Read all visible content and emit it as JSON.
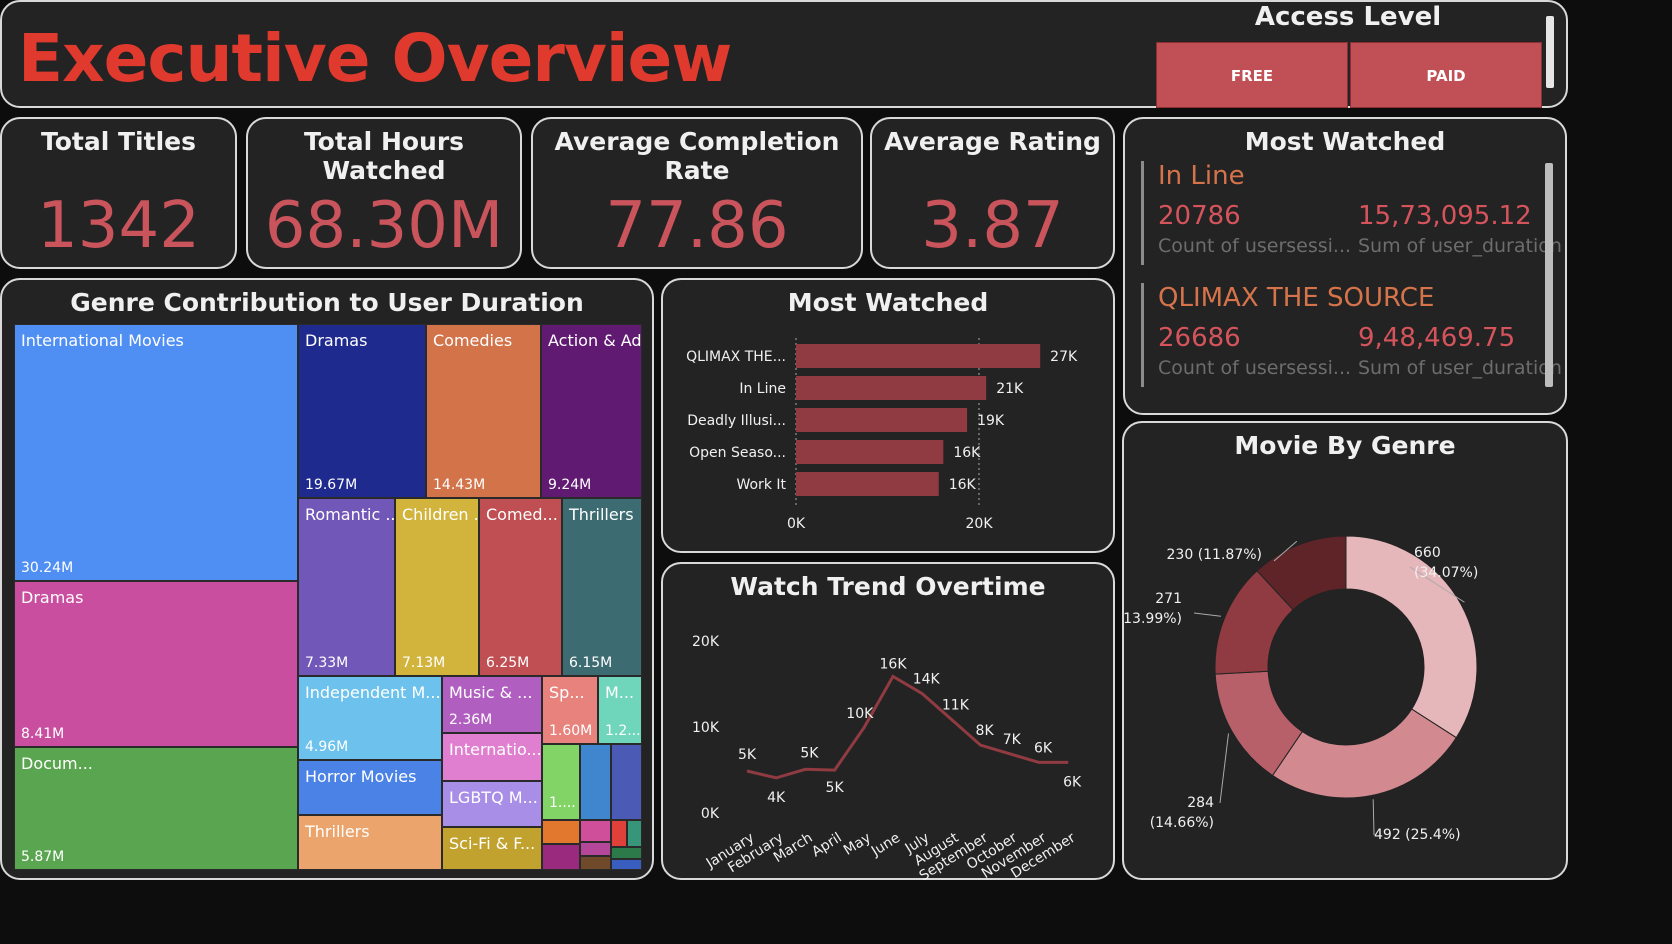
{
  "header": {
    "title": "Executive Overview",
    "access_level": "Access Level",
    "free_label": "FREE",
    "paid_label": "PAID"
  },
  "kpis": [
    {
      "title": "Total Titles",
      "value": "1342"
    },
    {
      "title": "Total Hours Watched",
      "value": "68.30M"
    },
    {
      "title": "Average Completion Rate",
      "value": "77.86"
    },
    {
      "title": "Average Rating",
      "value": "3.87"
    }
  ],
  "most_watched_card": {
    "title": "Most Watched",
    "items": [
      {
        "name": "In Line",
        "count": "20786",
        "sum": "15,73,095.12",
        "count_label": "Count of usersessi...",
        "sum_label": "Sum of user_duration"
      },
      {
        "name": "QLIMAX THE SOURCE",
        "count": "26686",
        "sum": "9,48,469.75",
        "count_label": "Count of usersessi...",
        "sum_label": "Sum of user_duration"
      }
    ]
  },
  "treemap": {
    "title": "Genre Contribution to User Duration",
    "tiles": [
      {
        "name": "International Movies",
        "value": "30.24M",
        "color": "#4f8ff4"
      },
      {
        "name": "Dramas",
        "value": "19.67M",
        "color": "#1f2a8f"
      },
      {
        "name": "Comedies",
        "value": "14.43M",
        "color": "#d2734a"
      },
      {
        "name": "Action & Adv...",
        "value": "9.24M",
        "color": "#611a72"
      },
      {
        "name": "Dramas",
        "value": "8.41M",
        "color": "#c94ea0"
      },
      {
        "name": "Romantic ...",
        "value": "7.33M",
        "color": "#7157b8"
      },
      {
        "name": "Children ...",
        "value": "7.13M",
        "color": "#d2b43c"
      },
      {
        "name": "Comed...",
        "value": "6.25M",
        "color": "#c04f53"
      },
      {
        "name": "Thrillers",
        "value": "6.15M",
        "color": "#3c6b72"
      },
      {
        "name": "Docum...",
        "value": "5.87M",
        "color": "#5aa54f"
      },
      {
        "name": "Independent M...",
        "value": "4.96M",
        "color": "#6cc2ec"
      },
      {
        "name": "Music & ...",
        "value": "2.36M",
        "color": "#b05fc0"
      },
      {
        "name": "Sp...",
        "value": "1.60M",
        "color": "#e8827c"
      },
      {
        "name": "M...",
        "value": "1.2...",
        "color": "#6fd5bb"
      },
      {
        "name": "Horror Movies",
        "value": "",
        "color": "#4a82e6"
      },
      {
        "name": "Internatio...",
        "value": "",
        "color": "#e07fd0"
      },
      {
        "name": "LGBTQ M...",
        "value": "",
        "color": "#a98ee8"
      },
      {
        "name": "Thrillers",
        "value": "",
        "color": "#eba46b"
      },
      {
        "name": "Sci-Fi & F...",
        "value": "",
        "color": "#c2a22f"
      },
      {
        "name": "",
        "value": "1....",
        "color": "#83d466"
      },
      {
        "name": "",
        "value": "",
        "color": "#3f86cf"
      },
      {
        "name": "",
        "value": "",
        "color": "#4b5bb5"
      },
      {
        "name": "",
        "value": "",
        "color": "#37957a"
      }
    ]
  },
  "bar_card": {
    "title": "Most Watched"
  },
  "line_card": {
    "title": "Watch Trend Overtime"
  },
  "donut_card": {
    "title": "Movie By Genre"
  },
  "chart_data": [
    {
      "type": "bar",
      "orientation": "horizontal",
      "categories": [
        "QLIMAX THE...",
        "In Line",
        "Deadly Illusi...",
        "Open Seaso...",
        "Work It"
      ],
      "values": [
        26686,
        20786,
        18700,
        16100,
        15600
      ],
      "data_labels": [
        "27K",
        "21K",
        "19K",
        "16K",
        "16K"
      ],
      "xlim": [
        0,
        27000
      ],
      "x_ticks": [
        "0K",
        "20K"
      ],
      "color": "#8f3b41"
    },
    {
      "type": "line",
      "x": [
        "January",
        "February",
        "March",
        "April",
        "May",
        "June",
        "July",
        "August",
        "September",
        "October",
        "November",
        "December"
      ],
      "values": [
        5000,
        4200,
        5200,
        5100,
        10000,
        16000,
        14000,
        11000,
        8000,
        7000,
        6000,
        6000
      ],
      "data_labels": [
        "5K",
        "4K",
        "5K",
        "5K",
        "10K",
        "16K",
        "14K",
        "11K",
        "8K",
        "7K",
        "6K",
        "6K"
      ],
      "ylim": [
        0,
        20000
      ],
      "y_ticks": [
        "0K",
        "10K",
        "20K"
      ],
      "color": "#8f3b41"
    },
    {
      "type": "pie",
      "donut": true,
      "slices": [
        {
          "value": 660,
          "label_top": "660",
          "label_bottom": "(34.07%)",
          "color": "#e5b6ba"
        },
        {
          "value": 492,
          "label_top": "492 (25.4%)",
          "label_bottom": "",
          "color": "#d28a90"
        },
        {
          "value": 284,
          "label_top": "284",
          "label_bottom": "(14.66%)",
          "color": "#b7606a"
        },
        {
          "value": 271,
          "label_top": "271",
          "label_bottom": "(13.99%)",
          "color": "#8f3b41"
        },
        {
          "value": 230,
          "label_top": "230 (11.87%)",
          "label_bottom": "",
          "color": "#5e2428"
        }
      ]
    }
  ]
}
